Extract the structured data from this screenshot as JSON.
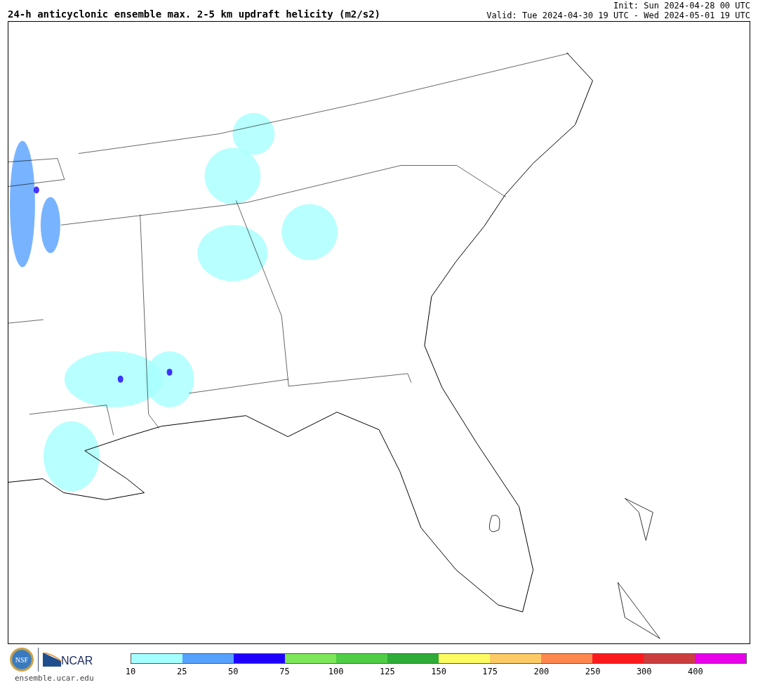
{
  "header": {
    "title": "24-h anticyclonic ensemble max. 2-5 km updraft helicity (m2/s2)",
    "init": "Init: Sun 2024-04-28 00 UTC",
    "valid": "Valid: Tue 2024-04-30 19 UTC - Wed 2024-05-01 19 UTC"
  },
  "footer": {
    "nsf_logo": "NSF",
    "ncar_logo": "NCAR",
    "url": "ensemble.ucar.edu"
  },
  "colorbar": {
    "segments": [
      {
        "color": "#a6ffff",
        "label": "10"
      },
      {
        "color": "#56a0ff",
        "label": "25"
      },
      {
        "color": "#1e00ff",
        "label": "50"
      },
      {
        "color": "#7ee65a",
        "label": "75"
      },
      {
        "color": "#50cd46",
        "label": "100"
      },
      {
        "color": "#2eac37",
        "label": "125"
      },
      {
        "color": "#fcfc62",
        "label": "150"
      },
      {
        "color": "#fdcb66",
        "label": "175"
      },
      {
        "color": "#fd874f",
        "label": "200"
      },
      {
        "color": "#fd1a1d",
        "label": "250"
      },
      {
        "color": "#cb3e3d",
        "label": "300"
      },
      {
        "color": "#e700e9",
        "label": "400"
      }
    ]
  }
}
